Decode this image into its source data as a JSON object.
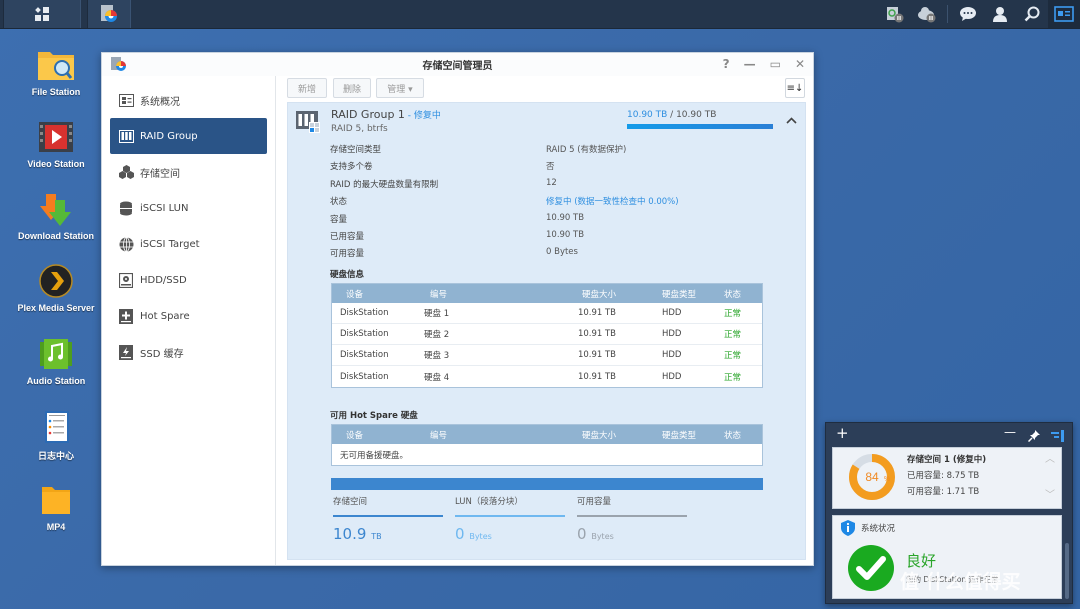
{
  "taskbar": {
    "main_menu_icon": "apps-grid-icon",
    "open_app_icon": "storage-manager-icon",
    "tray_icons": [
      "backup-paused-icon",
      "cloud-sync-paused-icon",
      "chat-icon",
      "user-icon",
      "search-icon",
      "widgets-icon"
    ]
  },
  "desktop": {
    "icons": [
      {
        "label": "File Station",
        "icon": "file-station-icon"
      },
      {
        "label": "Video Station",
        "icon": "video-station-icon"
      },
      {
        "label": "Download Station",
        "icon": "download-station-icon"
      },
      {
        "label": "Plex Media Server",
        "icon": "plex-icon"
      },
      {
        "label": "Audio Station",
        "icon": "audio-station-icon"
      },
      {
        "label": "日志中心",
        "icon": "log-center-icon"
      },
      {
        "label": "MP4",
        "icon": "folder-icon"
      }
    ]
  },
  "window": {
    "title": "存储空间管理员",
    "controls": [
      "?",
      "—",
      "▭",
      "✕"
    ],
    "sidebar": [
      {
        "label": "系统概况",
        "icon": "overview-icon",
        "active": false
      },
      {
        "label": "RAID Group",
        "icon": "raid-icon",
        "active": true
      },
      {
        "label": "存储空间",
        "icon": "volume-icon",
        "active": false
      },
      {
        "label": "iSCSI LUN",
        "icon": "lun-icon",
        "active": false
      },
      {
        "label": "iSCSI Target",
        "icon": "globe-icon",
        "active": false
      },
      {
        "label": "HDD/SSD",
        "icon": "hdd-icon",
        "active": false
      },
      {
        "label": "Hot Spare",
        "icon": "hot-spare-icon",
        "active": false
      },
      {
        "label": "SSD 缓存",
        "icon": "ssd-cache-icon",
        "active": false
      }
    ],
    "toolbar": {
      "create": "新增",
      "delete": "删除",
      "manage": "管理 ▾",
      "sort_icon": "≡↓"
    },
    "raid": {
      "name": "RAID Group 1",
      "status_suffix": " - 修复中",
      "subtitle": "RAID 5, btrfs",
      "capacity_used": "10.90 TB",
      "capacity_sep": " / ",
      "capacity_total": "10.90 TB",
      "capacity_fraction": 1.0,
      "collapse_icon": "^",
      "properties": [
        {
          "key": "存储空间类型",
          "value": "RAID 5 (有数据保护)"
        },
        {
          "key": "支持多个卷",
          "value": "否"
        },
        {
          "key": "RAID 的最大硬盘数量有限制",
          "value": "12"
        },
        {
          "key": "状态",
          "value": "修复中 (数据一致性检查中 0.00%)",
          "highlight": true
        },
        {
          "key": "容量",
          "value": "10.90 TB"
        },
        {
          "key": "已用容量",
          "value": "10.90 TB"
        },
        {
          "key": "可用容量",
          "value": "0 Bytes"
        }
      ],
      "disk_section_title": "硬盘信息",
      "columns": [
        "设备",
        "编号",
        "硬盘大小",
        "硬盘类型",
        "状态"
      ],
      "disks": [
        {
          "device": "DiskStation",
          "id": "硬盘 1",
          "size": "10.91 TB",
          "type": "HDD",
          "status": "正常"
        },
        {
          "device": "DiskStation",
          "id": "硬盘 2",
          "size": "10.91 TB",
          "type": "HDD",
          "status": "正常"
        },
        {
          "device": "DiskStation",
          "id": "硬盘 3",
          "size": "10.91 TB",
          "type": "HDD",
          "status": "正常"
        },
        {
          "device": "DiskStation",
          "id": "硬盘 4",
          "size": "10.91 TB",
          "type": "HDD",
          "status": "正常"
        }
      ],
      "spare_section_title": "可用 Hot Spare 硬盘",
      "spare_empty": "无可用备援硬盘。",
      "stats": [
        {
          "label": "存储空间",
          "value": "10.9",
          "unit": "TB",
          "color": "#3c86cf"
        },
        {
          "label": "LUN（段落分块）",
          "value": "0",
          "unit": "Bytes",
          "color": "#6fb8f0"
        },
        {
          "label": "可用容量",
          "value": "0",
          "unit": "Bytes",
          "color": "#9aa3ad"
        }
      ]
    }
  },
  "widget": {
    "add": "+",
    "minimize": "—",
    "pin_icon": "pin-icon",
    "layout_icon": "widget-layout-icon",
    "volume": {
      "title": "存储空间 1 (修复中)",
      "percent": 84,
      "percent_label": "84",
      "used": "已用容量: 8.75 TB",
      "free": "可用容量: 1.71 TB"
    },
    "health": {
      "title": "系统状况",
      "status": "良好",
      "detail": "您的 DiskStation 运作正常"
    }
  },
  "watermark": "值 什么值得买"
}
